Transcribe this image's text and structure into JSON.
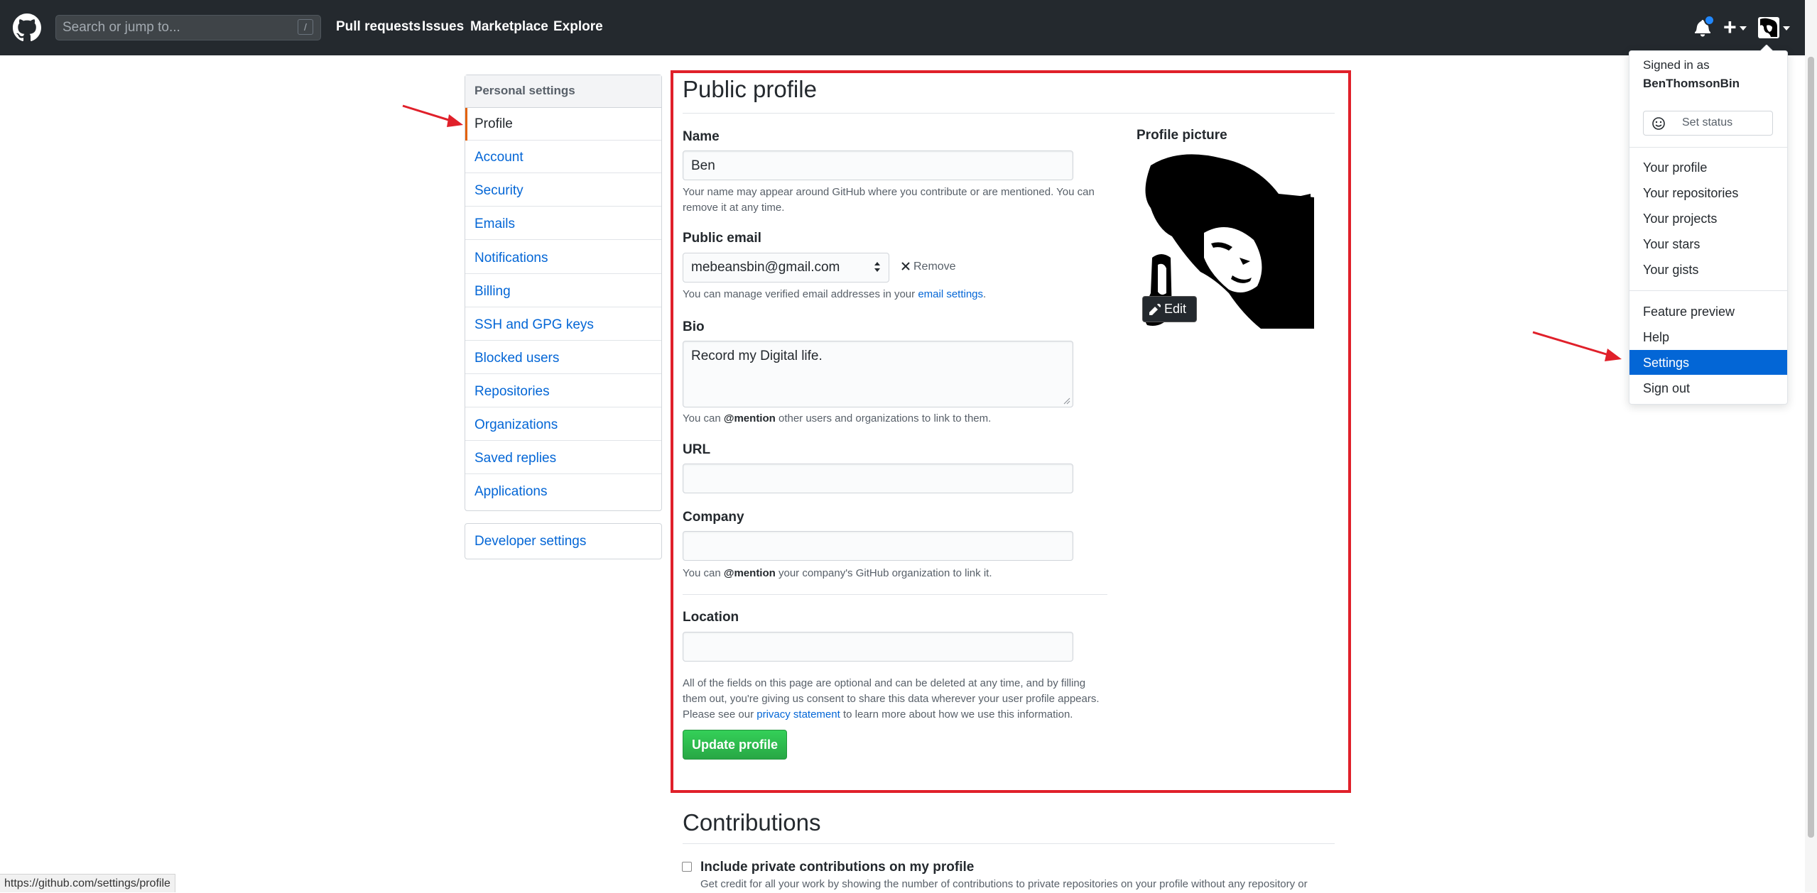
{
  "header": {
    "search_placeholder": "Search or jump to...",
    "search_shortcut": "/",
    "nav": [
      "Pull requests",
      "Issues",
      "Marketplace",
      "Explore"
    ],
    "plus_symbol": "+",
    "accent": "#24292e"
  },
  "sidebar": {
    "heading": "Personal settings",
    "items": [
      {
        "label": "Profile"
      },
      {
        "label": "Account"
      },
      {
        "label": "Security"
      },
      {
        "label": "Emails"
      },
      {
        "label": "Notifications"
      },
      {
        "label": "Billing"
      },
      {
        "label": "SSH and GPG keys"
      },
      {
        "label": "Blocked users"
      },
      {
        "label": "Repositories"
      },
      {
        "label": "Organizations"
      },
      {
        "label": "Saved replies"
      },
      {
        "label": "Applications"
      }
    ],
    "developer": "Developer settings"
  },
  "profile": {
    "title": "Public profile",
    "name_label": "Name",
    "name_value": "Ben",
    "name_note": "Your name may appear around GitHub where you contribute or are mentioned. You can remove it at any time.",
    "email_label": "Public email",
    "email_value": "mebeansbin@gmail.com",
    "remove_label": "Remove",
    "email_note_pre": "You can manage verified email addresses in your ",
    "email_note_link": "email settings",
    "email_note_post": ".",
    "bio_label": "Bio",
    "bio_value": "Record my Digital life.",
    "bio_note_pre": "You can ",
    "bio_note_bold": "@mention",
    "bio_note_post": " other users and organizations to link to them.",
    "url_label": "URL",
    "url_value": "",
    "company_label": "Company",
    "company_value": "",
    "company_note_pre": "You can ",
    "company_note_bold": "@mention",
    "company_note_post": " your company's GitHub organization to link it.",
    "location_label": "Location",
    "location_value": "",
    "footer_note_1": "All of the fields on this page are optional and can be deleted at any time, and by filling them out, you're giving us consent to share this data wherever your user profile appears.",
    "footer_note_2_pre": "Please see our ",
    "footer_note_2_link": "privacy statement",
    "footer_note_2_post": " to learn more about how we use this information.",
    "update_button": "Update profile",
    "picture_label": "Profile picture",
    "edit_button": "Edit"
  },
  "contributions": {
    "title": "Contributions",
    "checkbox_label": "Include private contributions on my profile",
    "checkbox_checked": false,
    "checkbox_note": "Get credit for all your work by showing the number of contributions to private repositories on your profile without any repository or"
  },
  "dropdown": {
    "signed_in_as": "Signed in as",
    "username": "BenThomsonBin",
    "set_status": "Set status",
    "group1": [
      "Your profile",
      "Your repositories",
      "Your projects",
      "Your stars",
      "Your gists"
    ],
    "group2": [
      "Feature preview",
      "Help",
      "Settings",
      "Sign out"
    ],
    "active_item": "Settings",
    "active_color": "#0366d6"
  },
  "status_bar": {
    "url": "https://github.com/settings/profile"
  },
  "annotation_color": "#e0202a"
}
